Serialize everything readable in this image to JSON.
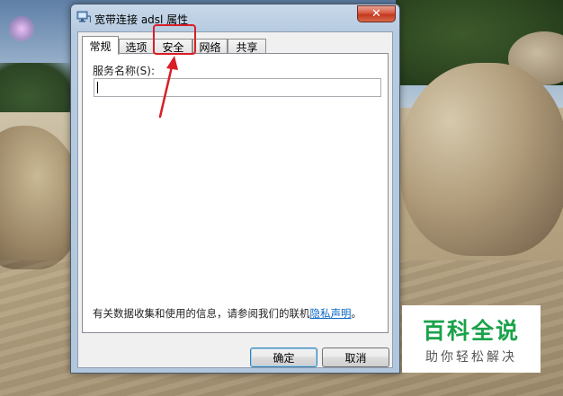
{
  "window": {
    "title": "宽带连接 adsl 属性",
    "close_glyph": "✕"
  },
  "tabs": [
    {
      "label": "常规",
      "active": true
    },
    {
      "label": "选项",
      "active": false
    },
    {
      "label": "安全",
      "active": false
    },
    {
      "label": "网络",
      "active": false
    },
    {
      "label": "共享",
      "active": false
    }
  ],
  "general": {
    "service_name_label": "服务名称(S):",
    "service_name_value": "",
    "privacy_text": "有关数据收集和使用的信息，请参阅我们的联机",
    "privacy_link": "隐私声明",
    "privacy_suffix": "。"
  },
  "buttons": {
    "ok": "确定",
    "cancel": "取消"
  },
  "annotation": {
    "color": "#d81e26",
    "target": "安全"
  },
  "watermark": {
    "title": "百科全说",
    "subtitle": "助你轻松解决",
    "title_color": "#1aa24a"
  },
  "icons": {
    "window_icon": "network-connection-icon",
    "close_icon": "close-icon"
  }
}
